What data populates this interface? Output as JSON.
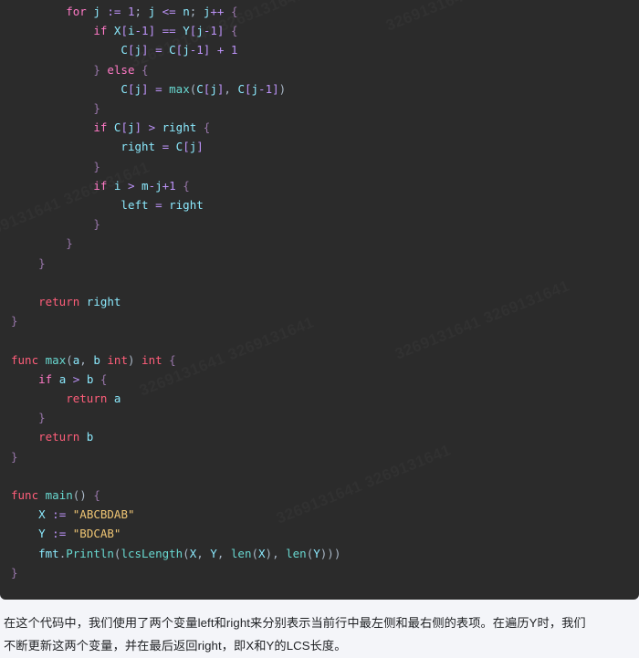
{
  "code_block": {
    "language": "go",
    "theme_colors": {
      "background": "#2b2b2b",
      "keyword": "#ff5e7a",
      "keyword_alt": "#ff79c6",
      "identifier": "#8be9fd",
      "function": "#68d8d0",
      "operator": "#bd93f9",
      "number": "#bd93f9",
      "string": "#f0c674",
      "punctuation": "#a9b7c6",
      "page_background": "#f4f5f9",
      "prose_text": "#1f2124"
    },
    "watermark_text": "3269131641  3269131641",
    "lines": [
      "        for j := 1; j <= n; j++ {",
      "            if X[i-1] == Y[j-1] {",
      "                C[j] = C[j-1] + 1",
      "            } else {",
      "                C[j] = max(C[j], C[j-1])",
      "            }",
      "            if C[j] > right {",
      "                right = C[j]",
      "            }",
      "            if i > m-j+1 {",
      "                left = right",
      "            }",
      "        }",
      "    }",
      "",
      "    return right",
      "}",
      "",
      "func max(a, b int) int {",
      "    if a > b {",
      "        return a",
      "    }",
      "    return b",
      "}",
      "",
      "func main() {",
      "    X := \"ABCBDAB\"",
      "    Y := \"BDCAB\"",
      "    fmt.Println(lcsLength(X, Y, len(X), len(Y)))",
      "}"
    ]
  },
  "prose": {
    "paragraph_line_1": "在这个代码中，我们使用了两个变量left和right来分别表示当前行中最左侧和最右侧的表项。在遍历Y时，我们",
    "paragraph_line_2": "不断更新这两个变量，并在最后返回right，即X和Y的LCS长度。"
  }
}
